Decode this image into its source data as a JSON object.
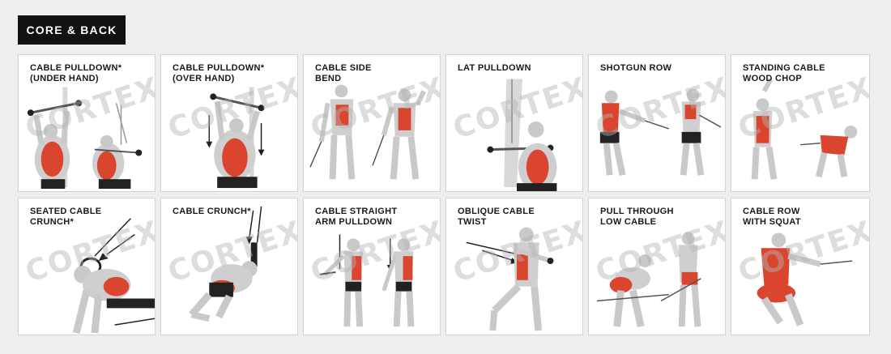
{
  "section_title": "CORE & BACK",
  "watermark": "CORTEX",
  "exercises": [
    {
      "label": "CABLE PULLDOWN*\n(UNDER HAND)"
    },
    {
      "label": "CABLE PULLDOWN*\n(OVER HAND)"
    },
    {
      "label": "CABLE SIDE\nBEND"
    },
    {
      "label": "LAT PULLDOWN"
    },
    {
      "label": "SHOTGUN ROW"
    },
    {
      "label": "STANDING CABLE\nWOOD CHOP"
    },
    {
      "label": "SEATED CABLE\nCRUNCH*"
    },
    {
      "label": "CABLE CRUNCH*"
    },
    {
      "label": "CABLE STRAIGHT\nARM PULLDOWN"
    },
    {
      "label": "OBLIQUE CABLE\nTWIST"
    },
    {
      "label": "PULL THROUGH\nLOW CABLE"
    },
    {
      "label": "CABLE ROW\nWITH SQUAT"
    }
  ],
  "colors": {
    "title_bg": "#111111",
    "title_fg": "#ffffff",
    "muscle": "#d9452f",
    "body": "#cfcfcf"
  }
}
